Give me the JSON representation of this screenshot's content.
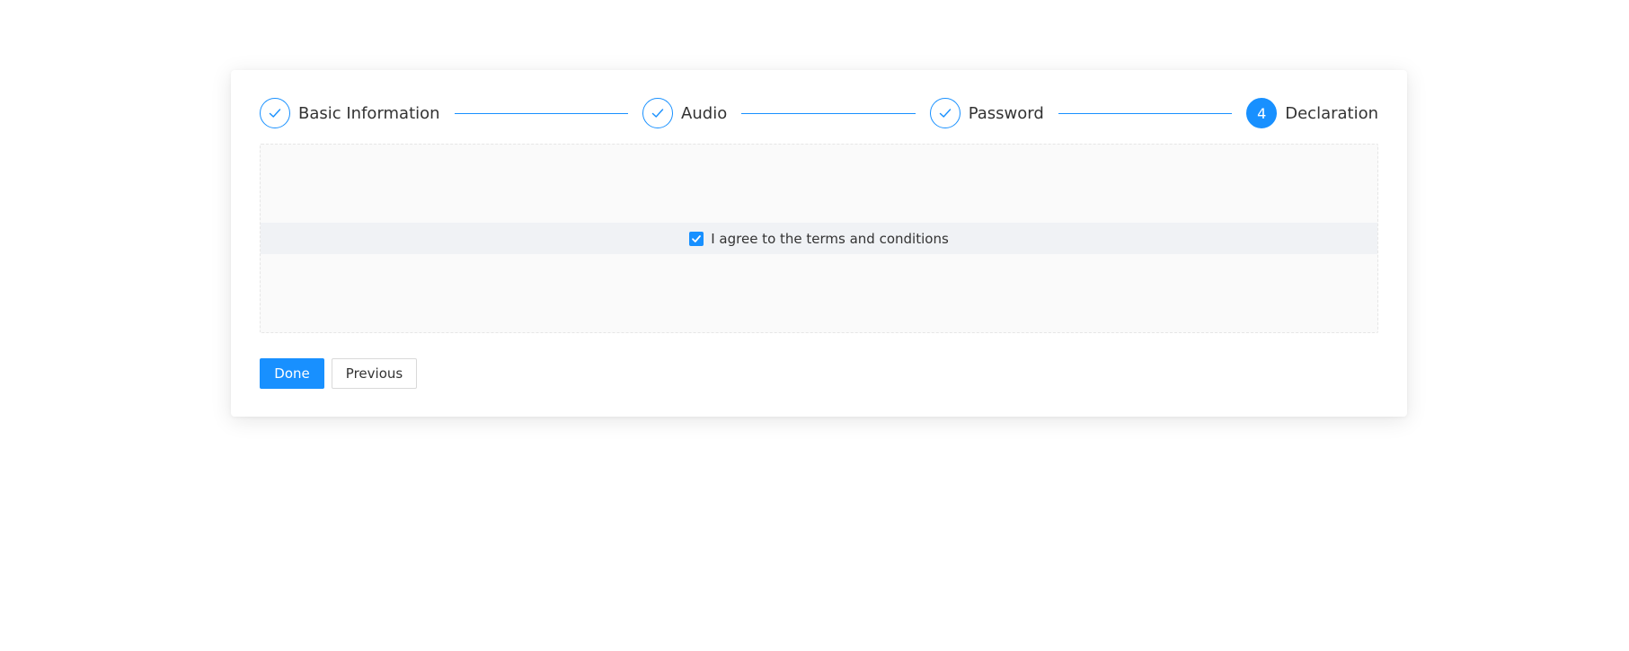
{
  "colors": {
    "accent": "#1890ff",
    "text": "#333333",
    "content_bg": "#fafafa",
    "row_bg": "#f0f2f5"
  },
  "steps": [
    {
      "label": "Basic Information",
      "status": "finished",
      "icon": "check-icon"
    },
    {
      "label": "Audio",
      "status": "finished",
      "icon": "check-icon"
    },
    {
      "label": "Password",
      "status": "finished",
      "icon": "check-icon"
    },
    {
      "label": "Declaration",
      "status": "current",
      "number": "4"
    }
  ],
  "agreement": {
    "label": "I agree to the terms and conditions",
    "checked": true,
    "icon": "checkmark-icon"
  },
  "actions": {
    "done_label": "Done",
    "previous_label": "Previous"
  }
}
